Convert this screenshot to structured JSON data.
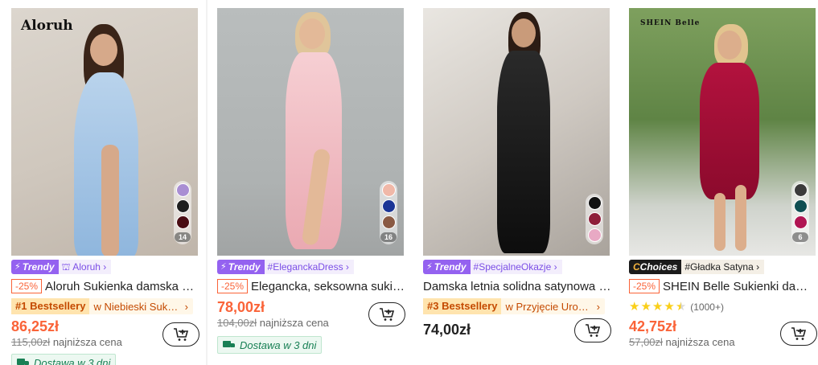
{
  "products": [
    {
      "brand_logo": "Aloruh",
      "image_subject": "light blue halter maxi dress",
      "swatches": [
        "#a98ed3",
        "#1e1e1e",
        "#4a0d14"
      ],
      "swatch_count": "14",
      "tag_badge": "Trendy",
      "tag_label": "Aloruh",
      "discount": "-25%",
      "title": "Aloruh Sukienka damska bez rękawów",
      "bestseller": "#1 Bestsellery",
      "bestseller_category": "w Niebieski Sukienki",
      "price": "86,25zł",
      "old_price": "115,00zł",
      "lowest_price_label": "najniższa cena",
      "shipping": "Dostawa w 3 dni"
    },
    {
      "image_subject": "pink satin maxi dress",
      "swatches": [
        "#f0b8a8",
        "#1b3596",
        "#8a5a44"
      ],
      "swatch_count": "16",
      "tag_badge": "Trendy",
      "tag_label": "#EleganckaDress",
      "discount": "-25%",
      "title": "Elegancka, seksowna sukienka satynowa",
      "price": "78,00zł",
      "old_price": "104,00zł",
      "lowest_price_label": "najniższa cena",
      "shipping": "Dostawa w 3 dni"
    },
    {
      "image_subject": "black satin slip maxi dress",
      "swatches": [
        "#111111",
        "#8e1f3a",
        "#e8a9c4"
      ],
      "tag_badge": "Trendy",
      "tag_label": "#SpecjalneOkazje",
      "title": "Damska letnia solidna satynowa sukienka",
      "bestseller": "#3 Bestsellery",
      "bestseller_category": "w Przyjęcie Urodzinowe",
      "price": "74,00zł"
    },
    {
      "brand_logo": "SHEIN Belle",
      "image_subject": "red satin midi dress",
      "swatches": [
        "#3b3b3b",
        "#0f4f53",
        "#b01553"
      ],
      "swatch_count": "6",
      "tag_badge": "Choices",
      "tag_label": "#Gładka Satyna",
      "discount": "-25%",
      "title": "SHEIN Belle Sukienki damskie satynowe",
      "rating": 4.5,
      "rating_count": "(1000+)",
      "price": "42,75zł",
      "old_price": "57,00zł",
      "lowest_price_label": "najniższa cena"
    }
  ],
  "icons": {
    "cart": "add-to-cart-icon",
    "truck": "truck-icon",
    "chevron": "chevron-right-icon",
    "star": "star-icon",
    "tag": "tag-icon"
  },
  "colors": {
    "accent": "#fa6338",
    "trendy": "#9462f0",
    "shipping": "#198055",
    "bestseller_text": "#c44a01"
  }
}
